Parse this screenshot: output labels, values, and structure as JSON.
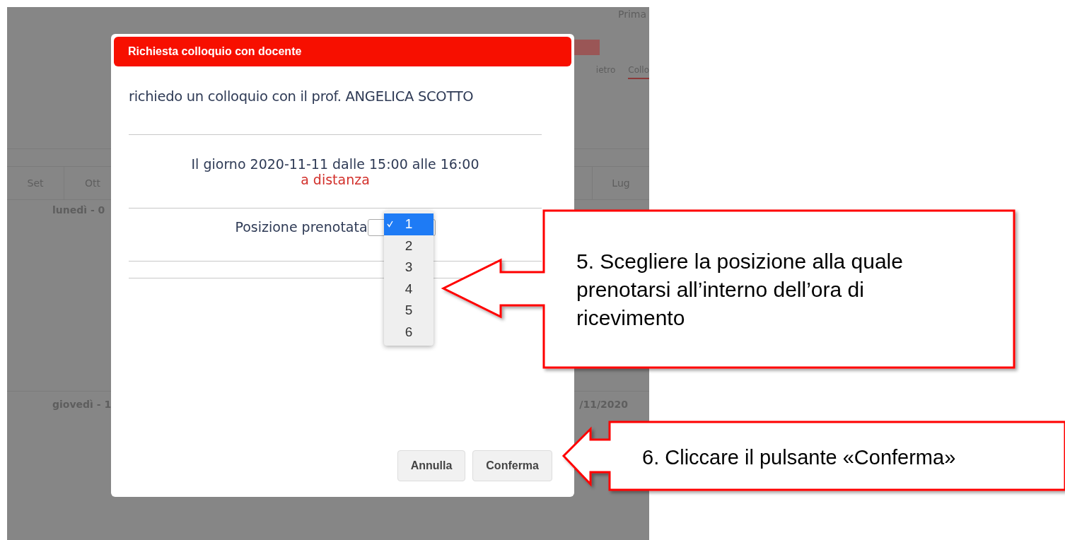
{
  "background_page": {
    "header_label": "Prima",
    "tabs": [
      {
        "label": "ietro",
        "selected": false
      },
      {
        "label": "Collo",
        "selected": true
      }
    ],
    "months": [
      "Set",
      "Ott",
      "Lug"
    ],
    "days": [
      {
        "label": "lunedì - 0"
      },
      {
        "label": "giovedì - 1",
        "date": "/11/2020"
      }
    ]
  },
  "modal": {
    "title": "Richiesta colloquio con docente",
    "request_text": "richiedo un colloquio con il prof. ANGELICA SCOTTO",
    "schedule_text": "Il giorno 2020-11-11 dalle 15:00 alle 16:00",
    "mode_text": "a distanza",
    "position_label": "Posizione prenotata",
    "options": [
      {
        "label": "1",
        "selected": true
      },
      {
        "label": "2",
        "selected": false
      },
      {
        "label": "3",
        "selected": false
      },
      {
        "label": "4",
        "selected": false
      },
      {
        "label": "5",
        "selected": false
      },
      {
        "label": "6",
        "selected": false
      }
    ],
    "buttons": [
      "Annulla",
      "Conferma"
    ]
  },
  "callouts": [
    {
      "text": "5. Scegliere la posizione alla quale prenotarsi all’interno dell’ora di ricevimento"
    },
    {
      "text": "6. Cliccare il pulsante «Conferma»"
    }
  ]
}
